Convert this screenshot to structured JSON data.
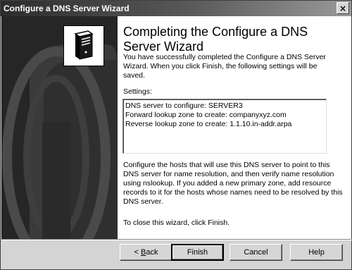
{
  "window": {
    "title": "Configure a DNS Server Wizard",
    "close_glyph": "×"
  },
  "page": {
    "title": "Completing the Configure a DNS Server Wizard",
    "intro": "You have successfully completed the Configure a DNS Server Wizard. When you click Finish, the following settings will be saved.",
    "settings_label": "Settings:",
    "settings": [
      "DNS server to configure: SERVER3",
      "Forward lookup zone to create: companyxyz.com",
      "Reverse lookup zone to create: 1.1.10.in-addr.arpa"
    ],
    "body": "Configure the hosts that will use this DNS server to point to this DNS server for name resolution, and then verify name resolution using nslookup. If you added a new primary zone, add resource records to it for the hosts whose names need to be resolved by this DNS server.",
    "close_instruction": "To close this wizard, click Finish."
  },
  "buttons": {
    "back_prefix": "< ",
    "back_mnemonic": "B",
    "back_rest": "ack",
    "finish": "Finish",
    "cancel": "Cancel",
    "help": "Help"
  },
  "icons": {
    "banner": "server-tower-icon"
  }
}
